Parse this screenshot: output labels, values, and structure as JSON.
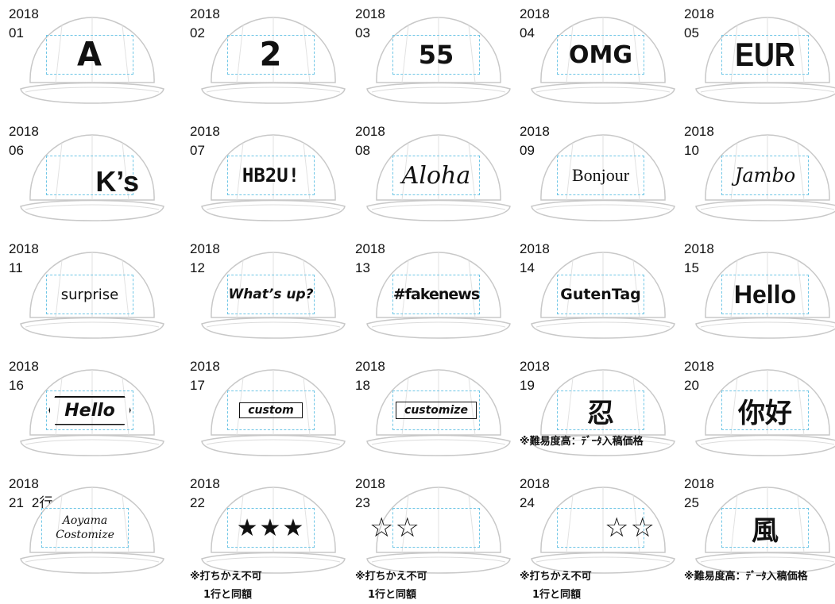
{
  "items": [
    {
      "year": "2018",
      "num": "01",
      "text": "A"
    },
    {
      "year": "2018",
      "num": "02",
      "text": "2"
    },
    {
      "year": "2018",
      "num": "03",
      "text": "55"
    },
    {
      "year": "2018",
      "num": "04",
      "text": "OMG"
    },
    {
      "year": "2018",
      "num": "05",
      "text": "EUR"
    },
    {
      "year": "2018",
      "num": "06",
      "text": "K’s"
    },
    {
      "year": "2018",
      "num": "07",
      "text": "HB2U!"
    },
    {
      "year": "2018",
      "num": "08",
      "text": "Aloha"
    },
    {
      "year": "2018",
      "num": "09",
      "text": "Bonjour"
    },
    {
      "year": "2018",
      "num": "10",
      "text": "Jambo"
    },
    {
      "year": "2018",
      "num": "11",
      "text": "surprise"
    },
    {
      "year": "2018",
      "num": "12",
      "text": "What’s up?"
    },
    {
      "year": "2018",
      "num": "13",
      "text": "#fakenews"
    },
    {
      "year": "2018",
      "num": "14",
      "text": "GutenTag"
    },
    {
      "year": "2018",
      "num": "15",
      "text": "Hello"
    },
    {
      "year": "2018",
      "num": "16",
      "text": "Hello"
    },
    {
      "year": "2018",
      "num": "17",
      "text": "custom"
    },
    {
      "year": "2018",
      "num": "18",
      "text": "customize"
    },
    {
      "year": "2018",
      "num": "19",
      "text": "忍",
      "note1": "※難易度高：ﾃﾞｰﾀ入稿価格"
    },
    {
      "year": "2018",
      "num": "20",
      "text": "你好"
    },
    {
      "year": "2018",
      "num": "21",
      "extra": "2行",
      "line1": "Aoyama",
      "line2": "Costomize"
    },
    {
      "year": "2018",
      "num": "22",
      "text": "★★★",
      "note1": "※打ちかえ不可",
      "note2": "1行と同額"
    },
    {
      "year": "2018",
      "num": "23",
      "text": "☆☆",
      "note1": "※打ちかえ不可",
      "note2": "1行と同額"
    },
    {
      "year": "2018",
      "num": "24",
      "text": "☆☆",
      "note1": "※打ちかえ不可",
      "note2": "1行と同額"
    },
    {
      "year": "2018",
      "num": "25",
      "text": "風",
      "note1": "※難易度高：ﾃﾞｰﾀ入稿価格"
    }
  ],
  "colors": {
    "print_area_border": "#6fc6e6",
    "cap_outline": "#c8c8c8",
    "ink": "#111111"
  }
}
